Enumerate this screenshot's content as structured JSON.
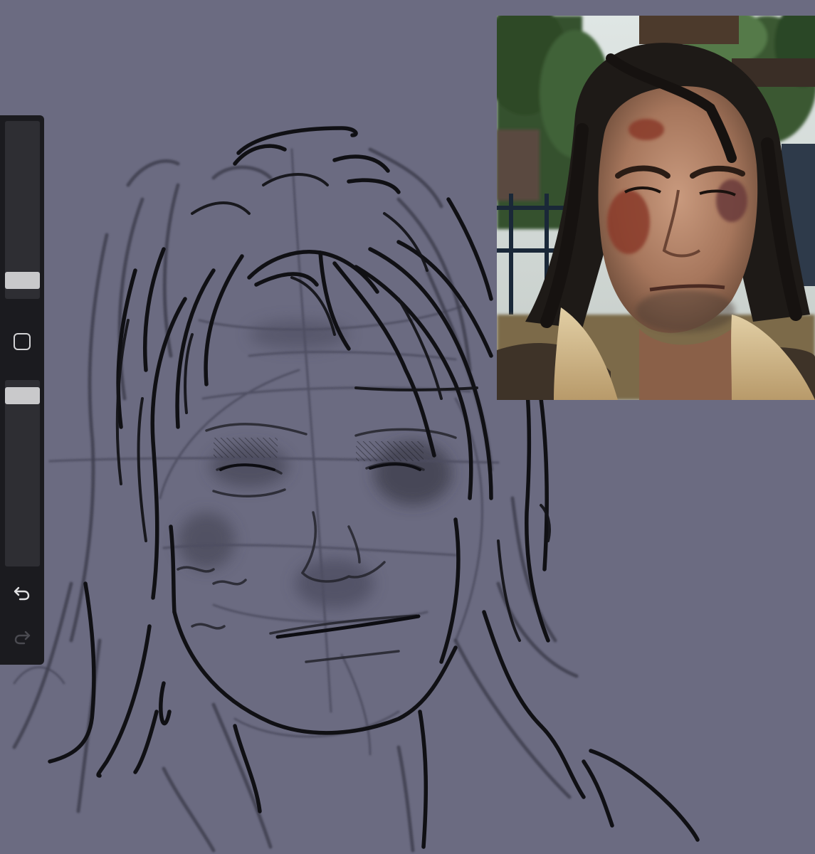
{
  "app": {
    "canvas_color": "#6b6b81",
    "sidebar_color": "#1b1b1f",
    "accent_thumb_color": "#c9c9cb"
  },
  "sidebar": {
    "brush_size": {
      "icon": "slider",
      "value": 0.06
    },
    "modify_button": {
      "icon": "square-icon"
    },
    "opacity": {
      "icon": "slider",
      "value": 0.96
    },
    "undo": {
      "icon": "undo-arrow-icon",
      "enabled": true
    },
    "redo": {
      "icon": "redo-arrow-icon",
      "enabled": false
    }
  },
  "reference": {
    "icon": "reference-photo",
    "description_colors": {
      "sky": "#dfe6e4",
      "trees": "#2f4a2a",
      "skin": "#b98a70",
      "hair": "#1e1a17",
      "fur_collar": "#d4b98a",
      "jacket": "#3e3328"
    }
  }
}
